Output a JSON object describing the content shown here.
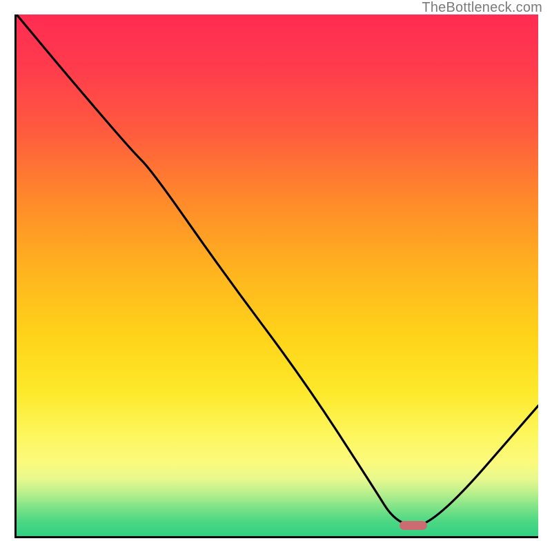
{
  "watermark": "TheBottleneck.com",
  "chart_data": {
    "type": "line",
    "title": "",
    "xlabel": "",
    "ylabel": "",
    "xlim": [
      0,
      100
    ],
    "ylim": [
      0,
      100
    ],
    "x": [
      0,
      10,
      22,
      26,
      40,
      55,
      68,
      73,
      80,
      100
    ],
    "values": [
      100,
      88,
      74,
      70,
      50,
      30,
      10,
      2,
      2,
      25
    ],
    "marker": {
      "x": 76,
      "y": 2,
      "color": "#cc6b72"
    },
    "gradient_stops": [
      {
        "pos": 0,
        "color": "#ff2c52"
      },
      {
        "pos": 50,
        "color": "#ffb61e"
      },
      {
        "pos": 80,
        "color": "#fdf65a"
      },
      {
        "pos": 100,
        "color": "#2fd083"
      }
    ]
  }
}
